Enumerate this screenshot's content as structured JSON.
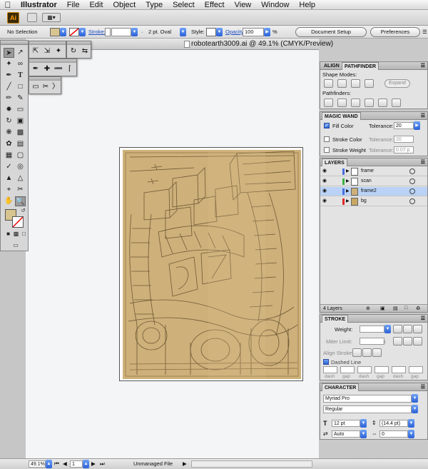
{
  "menubar": {
    "app": "Illustrator",
    "items": [
      "File",
      "Edit",
      "Object",
      "Type",
      "Select",
      "Effect",
      "View",
      "Window",
      "Help"
    ]
  },
  "appbar": {
    "logo": "Ai"
  },
  "controlbar": {
    "selection": "No Selection",
    "stroke_label": "Stroke:",
    "brush": "2 pt. Oval",
    "style_label": "Style:",
    "opacity_label": "Opacity:",
    "opacity_value": "100",
    "percent": "%",
    "doc_setup": "Document Setup",
    "preferences": "Preferences",
    "fill_color": "#d8c48f"
  },
  "document": {
    "title": "robotearth3009.ai @ 49.1% (CMYK/Preview)",
    "art_color": "#ceb07a"
  },
  "align_panel": {
    "tabs": [
      "ALIGN",
      "PATHFINDER"
    ],
    "shape_modes": "Shape Modes:",
    "expand": "Expand",
    "pathfinders": "Pathfinders:"
  },
  "magic_wand": {
    "title": "MAGIC WAND",
    "fill_color": "Fill Color",
    "stroke_color": "Stroke Color",
    "stroke_weight": "Stroke Weight",
    "tolerance_label": "Tolerance:",
    "fill_tolerance": "20",
    "stroke_tolerance": "20",
    "weight_tolerance": "0.07 p"
  },
  "layers": {
    "title": "LAYERS",
    "count": "4 Layers",
    "items": [
      {
        "name": "frame",
        "color": "#4a6fe0"
      },
      {
        "name": "scan",
        "color": "#3bb143"
      },
      {
        "name": "frame2",
        "color": "#4a6fe0"
      },
      {
        "name": "bg",
        "color": "#e02a2a"
      }
    ]
  },
  "stroke": {
    "title": "STROKE",
    "weight": "Weight:",
    "miter": "Miter Limit:",
    "align": "Align Stroke:",
    "dashed": "Dashed Line",
    "dash": "dash",
    "gap": "gap",
    "x_symbol": "x"
  },
  "character": {
    "title": "CHARACTER",
    "font": "Myriad Pro",
    "style": "Regular",
    "size": "12 pt",
    "leading": "(14.4 pt)",
    "kerning": "Auto",
    "tracking": "0"
  },
  "statusbar": {
    "zoom": "49.1%",
    "page": "1",
    "status": "Unmanaged File"
  }
}
